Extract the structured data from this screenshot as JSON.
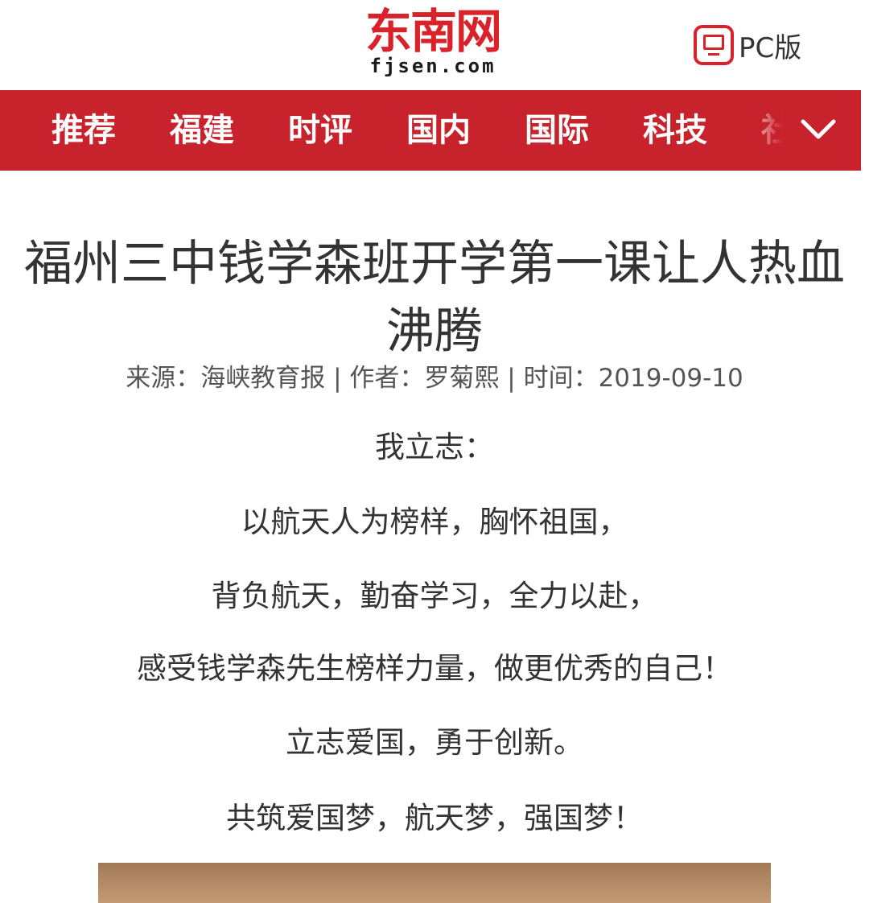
{
  "header": {
    "logo_cn": "东南网",
    "logo_en": "fjsen.com",
    "pc_label": "PC版",
    "pc_icon": "monitor-icon"
  },
  "nav": {
    "items": [
      "推荐",
      "福建",
      "时评",
      "国内",
      "国际",
      "科技",
      "社"
    ],
    "more_icon": "chevron-down-icon",
    "background": "#c8232c"
  },
  "article": {
    "title": "福州三中钱学森班开学第一课让人热血沸腾",
    "meta": "来源：海峡教育报 | 作者：罗菊熙 | 时间：2019-09-10",
    "paragraphs": [
      "我立志：",
      "以航天人为榜样，胸怀祖国，",
      "背负航天，勤奋学习，全力以赴，",
      "感受钱学森先生榜样力量，做更优秀的自己！",
      "立志爱国，勇于创新。",
      "共筑爱国梦，航天梦，强国梦！"
    ]
  },
  "colors": {
    "brand_red": "#d9222a"
  }
}
